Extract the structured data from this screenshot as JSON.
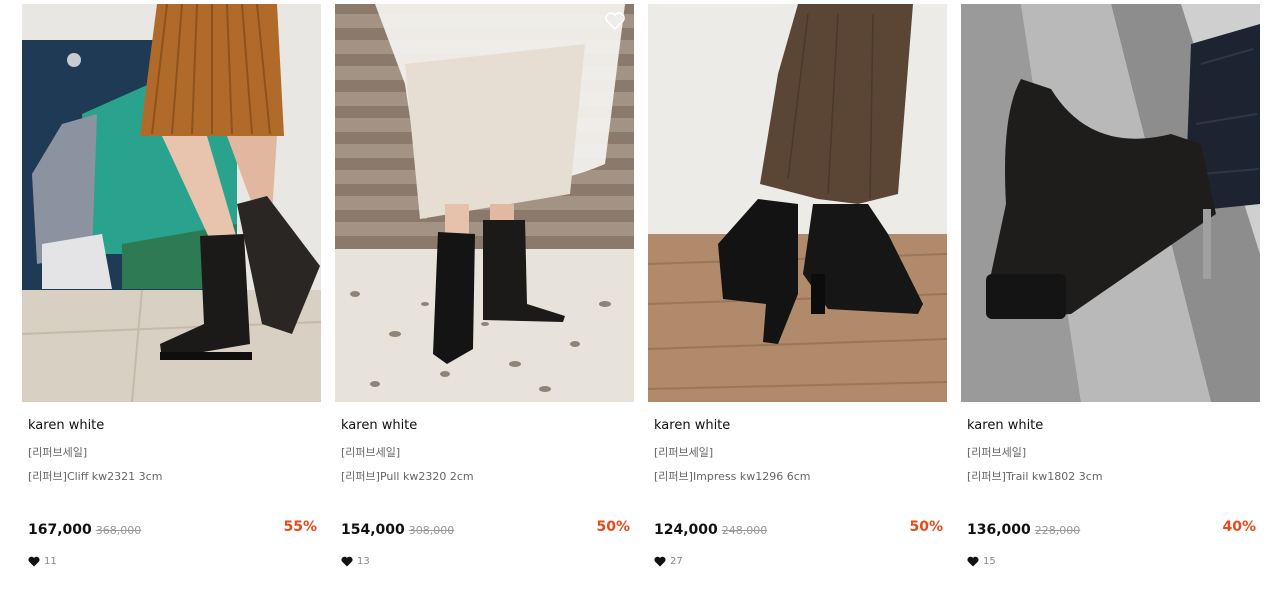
{
  "products": [
    {
      "brand": "karen white",
      "tag": "[리퍼브세일]",
      "name": "[리퍼브]Cliff kw2321 3cm",
      "price": "167,000",
      "original_price": "368,000",
      "discount": "55%",
      "likes": "11",
      "image": "long-boots-pleated-skirt-photo"
    },
    {
      "brand": "karen white",
      "tag": "[리퍼브세일]",
      "name": "[리퍼브]Pull kw2320 2cm",
      "price": "154,000",
      "original_price": "308,000",
      "discount": "50%",
      "likes": "13",
      "image": "mid-boots-tulle-skirt-photo"
    },
    {
      "brand": "karen white",
      "tag": "[리퍼브세일]",
      "name": "[리퍼브]Impress kw1296 6cm",
      "price": "124,000",
      "original_price": "248,000",
      "discount": "50%",
      "likes": "27",
      "image": "ankle-boots-corduroy-pants-photo"
    },
    {
      "brand": "karen white",
      "tag": "[리퍼브세일]",
      "name": "[리퍼브]Trail kw1802 3cm",
      "price": "136,000",
      "original_price": "228,000",
      "discount": "40%",
      "likes": "15",
      "image": "knit-sock-boot-denim-photo"
    }
  ],
  "colors": {
    "discount": "#e84a1a",
    "price": "#111111",
    "original_price": "#999999"
  },
  "icons": {
    "wishlist": "heart-outline-icon",
    "likes": "heart-filled-icon"
  }
}
